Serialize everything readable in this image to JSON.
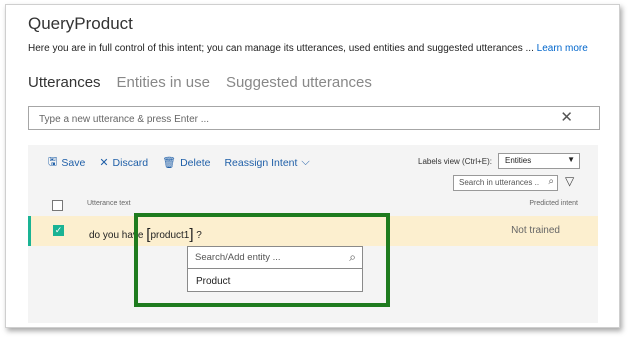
{
  "title": "QueryProduct",
  "description": {
    "text": "Here you are in full control of this intent; you can manage its utterances, used entities and suggested utterances ... ",
    "link": "Learn more"
  },
  "tabs": [
    {
      "label": "Utterances",
      "active": true
    },
    {
      "label": "Entities in use",
      "active": false
    },
    {
      "label": "Suggested utterances",
      "active": false
    }
  ],
  "utterance_input": {
    "placeholder": "Type a new utterance & press Enter ...",
    "value": ""
  },
  "toolbar": {
    "save": "Save",
    "discard": "Discard",
    "delete": "Delete",
    "reassign": "Reassign Intent"
  },
  "labels_view": {
    "label": "Labels view (Ctrl+E):",
    "selected": "Entities"
  },
  "search_utterances": {
    "placeholder": "Search in utterances ..."
  },
  "columns": {
    "utterance_text": "Utterance text",
    "predicted_intent": "Predicted intent"
  },
  "rows": [
    {
      "checked": true,
      "text_before": "do you have ",
      "entity": "product1",
      "text_after": " ?",
      "predicted": "Not trained"
    }
  ],
  "entity_popup": {
    "search_placeholder": "Search/Add entity ...",
    "options": [
      "Product"
    ]
  },
  "colors": {
    "accent": "#1ab394",
    "highlight_row": "#fcefcf",
    "link": "#0066cc",
    "callout_border": "#1e7b1e"
  }
}
